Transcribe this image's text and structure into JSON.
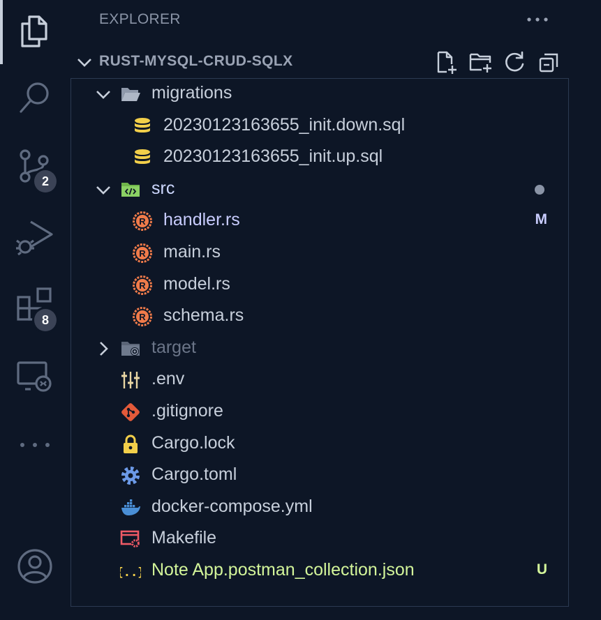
{
  "explorer": {
    "header": "EXPLORER"
  },
  "section": {
    "title": "RUST-MYSQL-CRUD-SQLX"
  },
  "activity": {
    "source_control_badge": "2",
    "extensions_badge": "8"
  },
  "tree": [
    {
      "label": "migrations",
      "icon": "folder-open-icon",
      "depth": 1,
      "chevron": "down",
      "color": "#c7cfdb"
    },
    {
      "label": "20230123163655_init.down.sql",
      "icon": "database-icon",
      "depth": 2,
      "color": "#c7cfdb"
    },
    {
      "label": "20230123163655_init.up.sql",
      "icon": "database-icon",
      "depth": 2,
      "color": "#c7cfdb"
    },
    {
      "label": "src",
      "icon": "src-folder-icon",
      "depth": 1,
      "chevron": "down",
      "color": "#cdd8ff",
      "status_dot": true
    },
    {
      "label": "handler.rs",
      "icon": "rust-icon",
      "depth": 2,
      "color": "#c9cdff",
      "status": "M",
      "status_color": "#c9cdff"
    },
    {
      "label": "main.rs",
      "icon": "rust-icon",
      "depth": 2,
      "color": "#c7cfdb"
    },
    {
      "label": "model.rs",
      "icon": "rust-icon",
      "depth": 2,
      "color": "#c7cfdb"
    },
    {
      "label": "schema.rs",
      "icon": "rust-icon",
      "depth": 2,
      "color": "#c7cfdb"
    },
    {
      "label": "target",
      "icon": "target-folder-icon",
      "depth": 1,
      "chevron": "right",
      "color": "#6b7588"
    },
    {
      "label": ".env",
      "icon": "env-icon",
      "depth": 1,
      "color": "#c7cfdb"
    },
    {
      "label": ".gitignore",
      "icon": "git-icon",
      "depth": 1,
      "color": "#c7cfdb"
    },
    {
      "label": "Cargo.lock",
      "icon": "lock-icon",
      "depth": 1,
      "color": "#c7cfdb"
    },
    {
      "label": "Cargo.toml",
      "icon": "gear-icon",
      "depth": 1,
      "color": "#c7cfdb"
    },
    {
      "label": "docker-compose.yml",
      "icon": "docker-icon",
      "depth": 1,
      "color": "#c7cfdb"
    },
    {
      "label": "Makefile",
      "icon": "makefile-icon",
      "depth": 1,
      "color": "#c7cfdb"
    },
    {
      "label": "Note App.postman_collection.json",
      "icon": "json-icon",
      "depth": 1,
      "color": "#d3f59a",
      "status": "U",
      "status_color": "#d3f59a"
    }
  ]
}
